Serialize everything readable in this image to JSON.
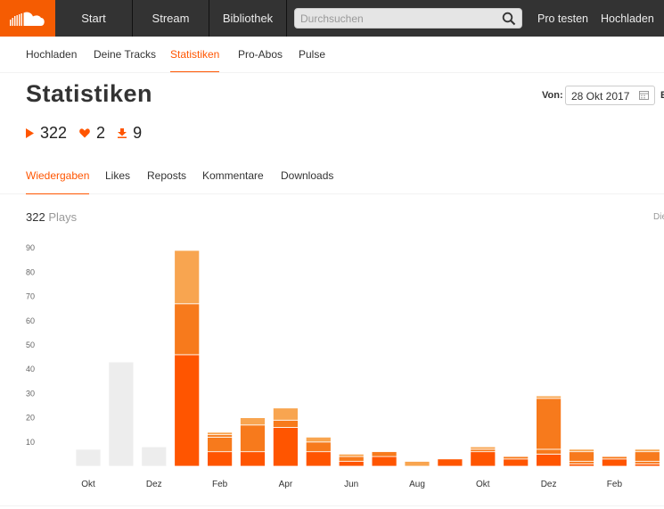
{
  "header": {
    "logo_icon": "soundcloud-cloud-icon",
    "nav": [
      "Start",
      "Stream",
      "Bibliothek"
    ],
    "search_placeholder": "Durchsuchen",
    "links": [
      "Pro testen",
      "Hochladen"
    ]
  },
  "subnav": {
    "items": [
      "Hochladen",
      "Deine Tracks",
      "Statistiken",
      "Pro-Abos",
      "Pulse"
    ],
    "active": "Statistiken"
  },
  "page": {
    "title": "Statistiken",
    "stats": {
      "plays": "322",
      "likes": "2",
      "downloads": "9"
    },
    "date_label": "Von:",
    "date_value": "28 Okt 2017",
    "date_next_cut": "B"
  },
  "metric_tabs": {
    "items": [
      "Wiedergaben",
      "Likes",
      "Reposts",
      "Kommentare",
      "Downloads"
    ],
    "active": "Wiedergaben"
  },
  "chart_header": {
    "total": "322",
    "unit": "Plays",
    "right_cut": "Die"
  },
  "colors": {
    "accent": "#ff5500",
    "light_orange": "#f8a550",
    "mid_orange": "#f77a1c",
    "inactive_bar": "#ededed",
    "header_bg": "#333333"
  },
  "chart_data": {
    "type": "bar",
    "stacked": true,
    "y_ticks": [
      10,
      20,
      30,
      40,
      50,
      60,
      70,
      80,
      90
    ],
    "ylim": [
      0,
      95
    ],
    "x_labels": [
      "Okt",
      "Dez",
      "Feb",
      "Apr",
      "Jun",
      "Aug",
      "Okt",
      "Dez",
      "Feb"
    ],
    "bars": [
      {
        "inactive": true,
        "segments": [
          7
        ]
      },
      {
        "inactive": true,
        "segments": [
          43
        ]
      },
      {
        "inactive": true,
        "segments": [
          8
        ]
      },
      {
        "segments": [
          46,
          21,
          22
        ]
      },
      {
        "segments": [
          6,
          6,
          1,
          1
        ]
      },
      {
        "segments": [
          6,
          11,
          3
        ]
      },
      {
        "segments": [
          16,
          3,
          5
        ]
      },
      {
        "segments": [
          6,
          4,
          2
        ]
      },
      {
        "segments": [
          2,
          2,
          1
        ]
      },
      {
        "segments": [
          4,
          2
        ]
      },
      {
        "segments": [
          0,
          0,
          2
        ]
      },
      {
        "segments": [
          3
        ]
      },
      {
        "segments": [
          6,
          1,
          1
        ]
      },
      {
        "segments": [
          3,
          1
        ]
      },
      {
        "segments": [
          5,
          2,
          21,
          1
        ]
      },
      {
        "segments": [
          1,
          1,
          4,
          1
        ]
      },
      {
        "segments": [
          3,
          1
        ]
      },
      {
        "segments": [
          1,
          1,
          4,
          1
        ]
      }
    ]
  }
}
